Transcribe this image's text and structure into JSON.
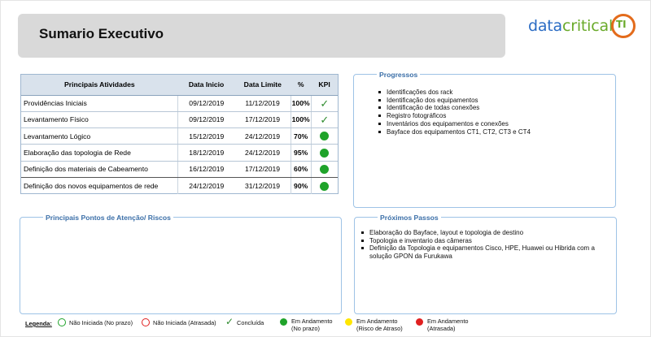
{
  "title": "Sumario Executivo",
  "logo": {
    "text_part1": "data",
    "text_part2": "critical",
    "badge": "TI"
  },
  "activities": {
    "headers": [
      "Principais Atividades",
      "Data Inicio",
      "Data Limite",
      "%",
      "KPI"
    ],
    "rows": [
      {
        "name": "Providências Iniciais",
        "start": "09/12/2019",
        "end": "11/12/2019",
        "pct": "100%",
        "kpi": "check"
      },
      {
        "name": "Levantamento Físico",
        "start": "09/12/2019",
        "end": "17/12/2019",
        "pct": "100%",
        "kpi": "check"
      },
      {
        "name": "Levantamento Lógico",
        "start": "15/12/2019",
        "end": "24/12/2019",
        "pct": "70%",
        "kpi": "green-dot"
      },
      {
        "name": "Elaboração das  topologia de Rede",
        "start": "18/12/2019",
        "end": "24/12/2019",
        "pct": "95%",
        "kpi": "green-dot"
      },
      {
        "name": "Definição dos materiais de Cabeamento",
        "start": "16/12/2019",
        "end": "17/12/2019",
        "pct": "60%",
        "kpi": "green-dot"
      },
      {
        "name": "Definição dos novos equipamentos de rede",
        "start": "24/12/2019",
        "end": "31/12/2019",
        "pct": "90%",
        "kpi": "green-dot"
      }
    ]
  },
  "progressos": {
    "title": "Progressos",
    "items": [
      "Identificações dos rack",
      "Identificação dos equipamentos",
      "Identificação de todas conexões",
      "Registro fotográficos",
      "Inventários dos equipamentos e conexões",
      "Bayface dos equipamentos CT1, CT2, CT3 e CT4"
    ]
  },
  "riscos": {
    "title": "Principais Pontos de Atenção/ Riscos"
  },
  "proximos": {
    "title": "Próximos Passos",
    "items": [
      "Elaboração do Bayface, layout e topologia de destino",
      "Topologia e inventario das câmeras",
      "Definição da Topologia e equipamentos Cisco, HPE, Huawei ou Hibrida com a solução GPON da Furukawa"
    ]
  },
  "legend": {
    "label": "Legenda:",
    "items": [
      {
        "text": "Não Iniciada (No prazo)",
        "symbol": "ring",
        "color": "#1fa32a"
      },
      {
        "text": "Não Iniciada (Atrasada)",
        "symbol": "ring",
        "color": "#e02020"
      },
      {
        "text": "Concluída",
        "symbol": "check",
        "color": "#2e8b2e"
      },
      {
        "text_line1": "Em Andamento",
        "text_line2": "(No prazo)",
        "symbol": "dot",
        "color": "#1fa32a"
      },
      {
        "text_line1": "Em Andamento",
        "text_line2": "(Risco de Atraso)",
        "symbol": "dot",
        "color": "#ffe600"
      },
      {
        "text_line1": "Em Andamento",
        "text_line2": "(Atrasada)",
        "symbol": "dot",
        "color": "#e02020"
      }
    ]
  }
}
